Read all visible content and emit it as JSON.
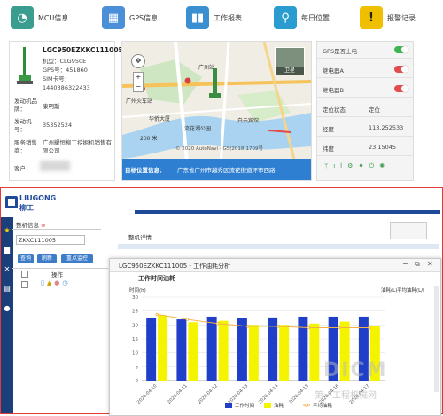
{
  "nav": {
    "items": [
      {
        "label": "MCU信息",
        "icon": "gauge-icon",
        "color": "#3a9d8f"
      },
      {
        "label": "GPS信息",
        "icon": "map-icon",
        "color": "#4a8fd8"
      },
      {
        "label": "工作报表",
        "icon": "chart-icon",
        "color": "#3a8fd0"
      },
      {
        "label": "每日位置",
        "icon": "location-pin-icon",
        "color": "#2b9ccf"
      },
      {
        "label": "报警记录",
        "icon": "warning-icon",
        "color": "#f0c000"
      }
    ]
  },
  "machine": {
    "id": "LGC950EZKKC111005",
    "model": "机型：CLG950E",
    "gps": "GPS号：451860",
    "sim_label": "SIM卡号：",
    "sim_value": "1440386322433",
    "engine_label": "发动机品牌：",
    "engine_value": "康明斯",
    "engine_no_label": "发动机号：",
    "engine_no_value": "35352524",
    "dealer_label": "服务销售商：",
    "dealer_value": "广州耀恒柳工挖掘机销售有限公司",
    "customer_label": "客户："
  },
  "map": {
    "labels": [
      "广州站",
      "广州火车站",
      "广州流花湖公园",
      "流花湖公园",
      "白云宾馆",
      "华侨大厦",
      "卫星"
    ],
    "copyright": "© 2020 AutoNavi - GS(2018)1709号",
    "scale": "200 米",
    "location_label": "目标位置信息：",
    "address": "广东省广州市越秀区流花街道环市西路"
  },
  "status": {
    "rows": [
      {
        "label": "GPS是否上电",
        "on": true
      },
      {
        "label": "继电器A",
        "on": true
      },
      {
        "label": "继电器B",
        "on": true
      }
    ],
    "loc_label": "定位状态",
    "loc_value": "定位",
    "lon_label": "经度",
    "lon_value": "113.252533",
    "lat_label": "纬度",
    "lat_value": "23.15045"
  },
  "bottom": {
    "brand": "LIUGONG",
    "brand_cn": "柳工",
    "tab_info": "整机信息",
    "search_value": "ZKKC111005",
    "btn_query": "查询",
    "btn_refresh": "刷新",
    "btn_monitor": "重点监控",
    "col_op": "操作",
    "list_title": "整机详情"
  },
  "dialog": {
    "title": "LGC950EZKKC111005 - 工作油耗分析",
    "chart_heading": "工作时间油耗"
  },
  "chart_data": {
    "type": "bar",
    "title": "工作时间油耗",
    "ylabel_left": "时间(h)",
    "ylabel_right1": "油耗(L)",
    "ylabel_right2": "平均油耗(L/h)",
    "ylim": [
      0,
      30
    ],
    "categories": [
      "2020-04-10",
      "2020-04-11",
      "2020-04-12",
      "2020-04-13",
      "2020-04-14",
      "2020-04-15",
      "2020-04-16",
      "2020-04-17"
    ],
    "series": [
      {
        "name": "工作时间",
        "color": "#1f3fc8",
        "values": [
          22.5,
          22.0,
          23.0,
          22.5,
          22.7,
          23.0,
          23.0,
          23.0
        ]
      },
      {
        "name": "油耗",
        "color": "#f4f400",
        "values": [
          23.5,
          21.0,
          21.5,
          20.0,
          20.0,
          20.5,
          21.2,
          19.5
        ]
      },
      {
        "name": "平均油耗",
        "color": "#f2b144",
        "values": [
          23.8,
          22.0,
          20.5,
          19.5,
          19.5,
          19.0,
          19.0,
          19.0
        ]
      }
    ]
  }
}
